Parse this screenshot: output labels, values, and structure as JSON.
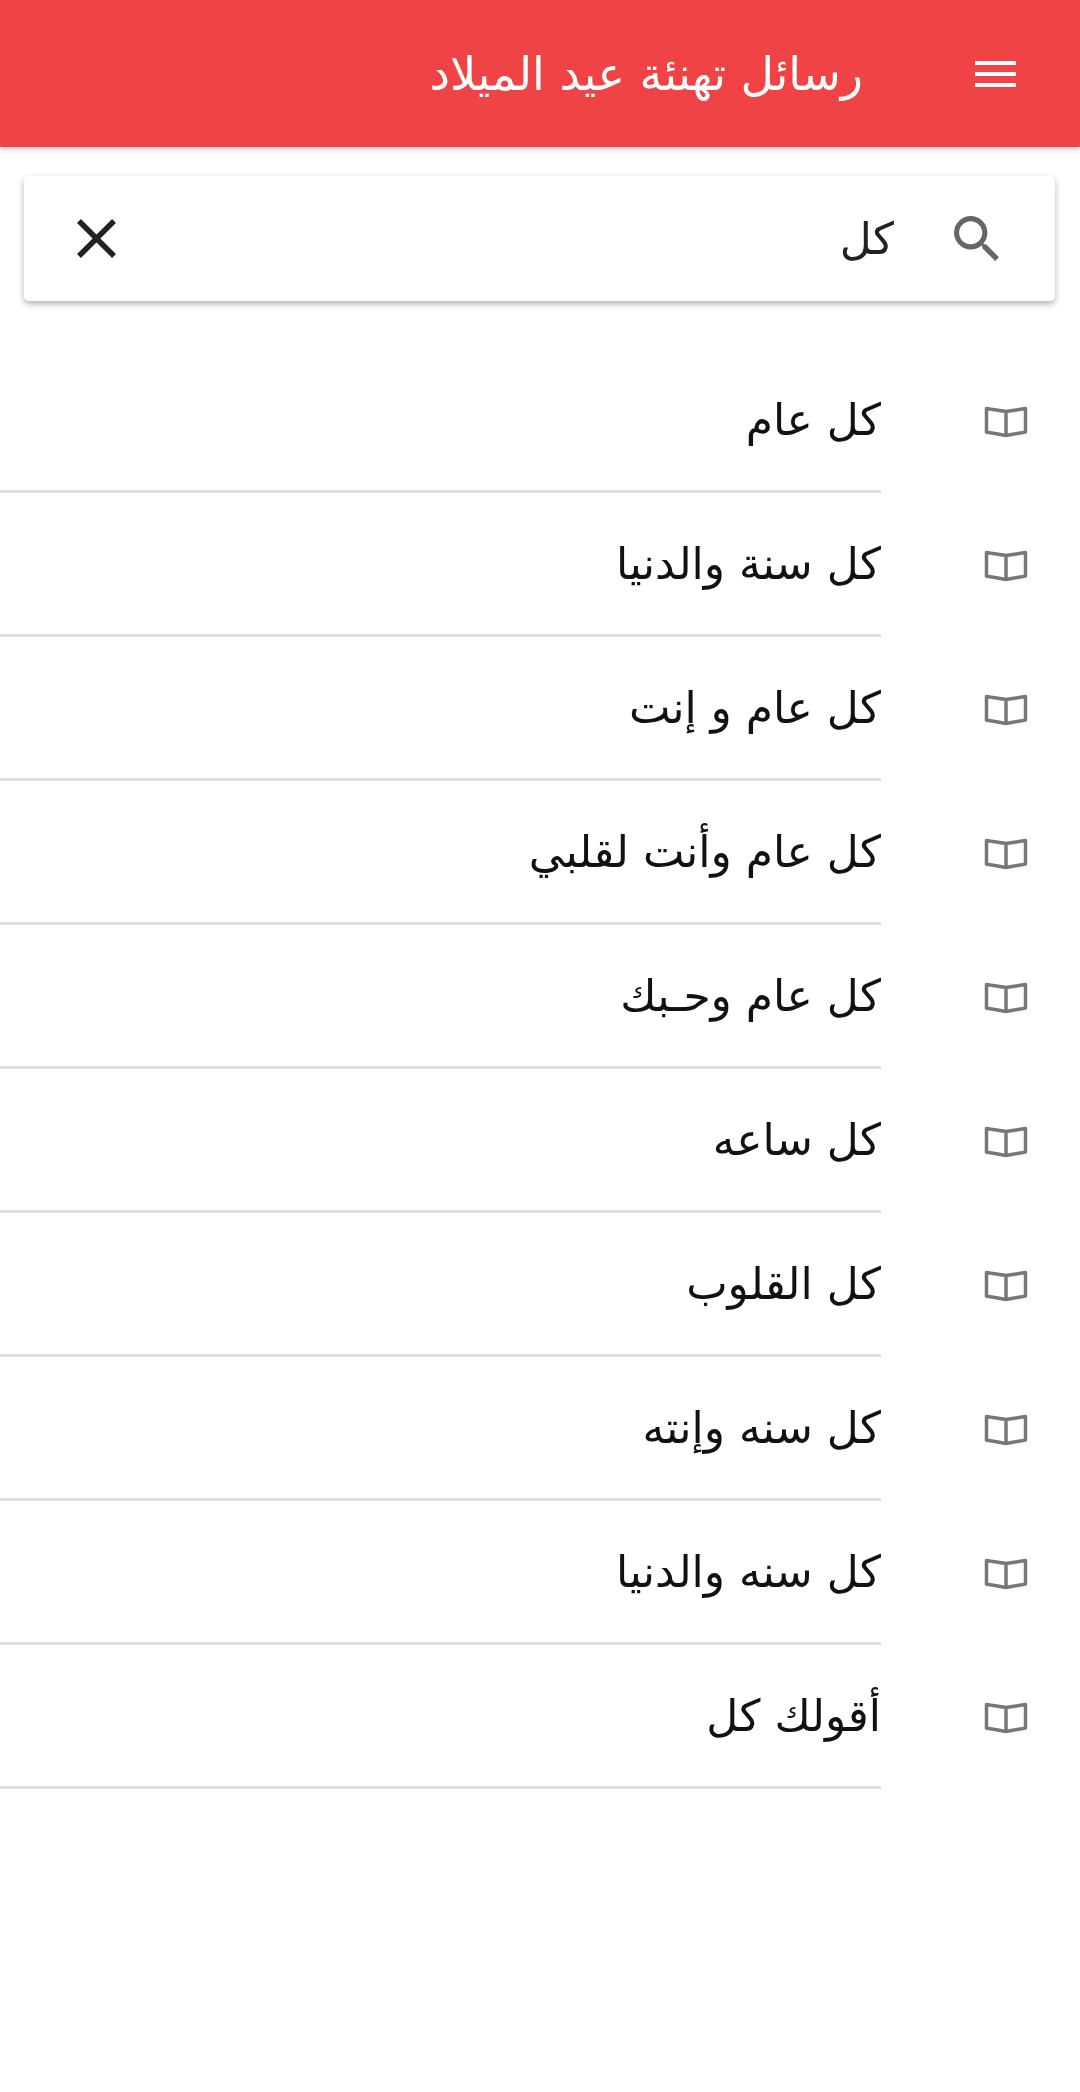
{
  "app_bar": {
    "title": "رسائل تهنئة عيد الميلاد"
  },
  "search": {
    "value": "كل"
  },
  "results": [
    {
      "title": "كل عام"
    },
    {
      "title": "كل سنة والدنيا"
    },
    {
      "title": "كل عام و إنت"
    },
    {
      "title": "كل عام وأنت لقلبي"
    },
    {
      "title": "كل عام وحـبك"
    },
    {
      "title": "كل ساعه"
    },
    {
      "title": "كل القلوب"
    },
    {
      "title": "كل سنه وإنته"
    },
    {
      "title": "كل سنه والدنيا"
    },
    {
      "title": "أقولك كل"
    }
  ]
}
